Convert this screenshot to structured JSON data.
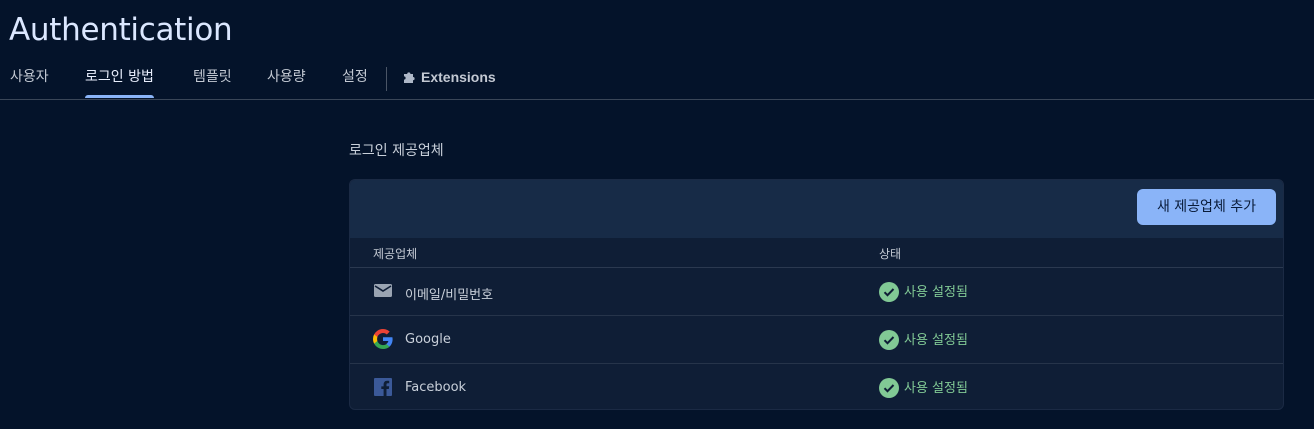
{
  "header": {
    "title": "Authentication"
  },
  "tabs": [
    {
      "label": "사용자",
      "active": false
    },
    {
      "label": "로그인 방법",
      "active": true
    },
    {
      "label": "템플릿",
      "active": false
    },
    {
      "label": "사용량",
      "active": false
    },
    {
      "label": "설정",
      "active": false
    },
    {
      "label": "Extensions",
      "active": false,
      "icon": "puzzle-icon"
    }
  ],
  "section": {
    "title": "로그인 제공업체"
  },
  "toolbar": {
    "add_label": "새 제공업체 추가"
  },
  "table": {
    "headers": {
      "provider": "제공업체",
      "status": "상태"
    },
    "rows": [
      {
        "name": "이메일/비밀번호",
        "icon": "mail-icon",
        "status": "사용 설정됨"
      },
      {
        "name": "Google",
        "icon": "google-icon",
        "status": "사용 설정됨"
      },
      {
        "name": "Facebook",
        "icon": "facebook-icon",
        "status": "사용 설정됨"
      }
    ]
  },
  "colors": {
    "accent": "#8ab4f8",
    "enabled": "#81c995",
    "background": "#04132a"
  }
}
